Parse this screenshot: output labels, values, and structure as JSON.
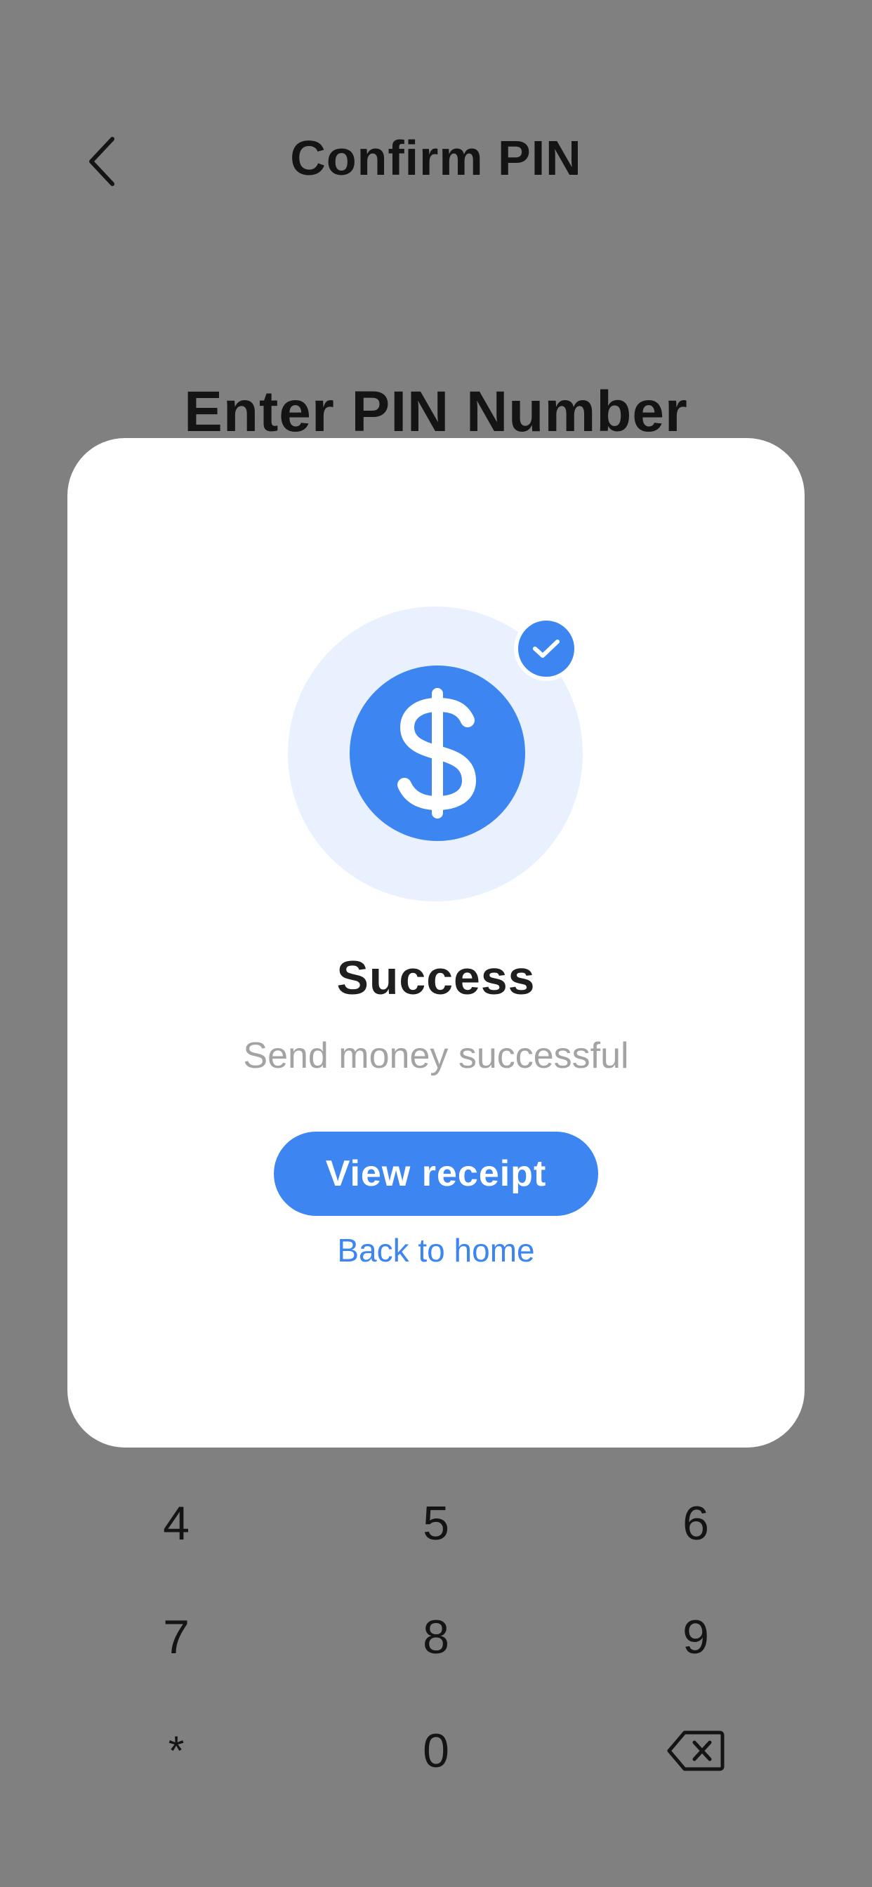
{
  "header": {
    "title": "Confirm PIN",
    "back_icon": "chevron-left-icon"
  },
  "pin_heading": "Enter PIN Number",
  "keypad": {
    "keys": [
      "4",
      "5",
      "6",
      "7",
      "8",
      "9",
      "*",
      "0"
    ],
    "backspace_icon": "backspace-icon"
  },
  "modal": {
    "icon": "dollar-coin-icon",
    "badge_icon": "check-badge-icon",
    "title": "Success",
    "subtitle": "Send money successful",
    "primary_button": "View receipt",
    "secondary_link": "Back to home"
  },
  "colors": {
    "overlay": "#808080",
    "accent": "#3d86f2",
    "halo": "#e8f1fd",
    "modal_bg": "#ffffff",
    "subtitle": "#a3a3a3"
  }
}
